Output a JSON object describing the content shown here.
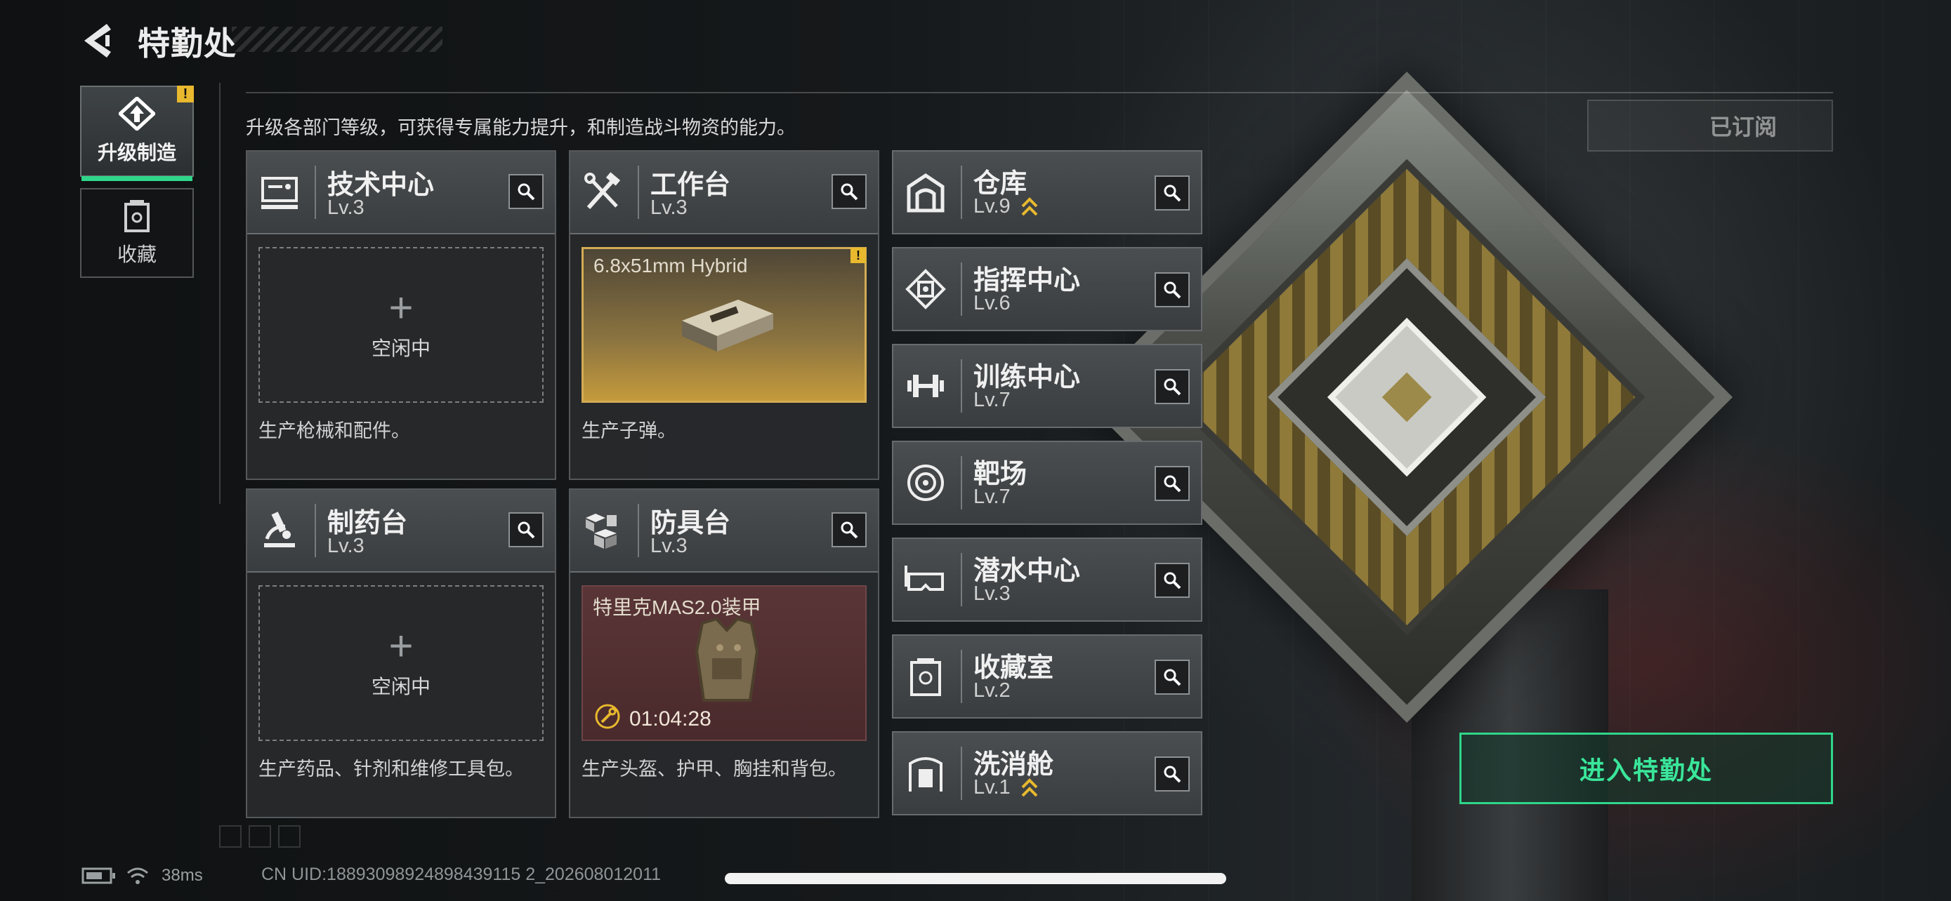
{
  "header": {
    "title": "特勤处",
    "back_icon": "back-arrow-icon"
  },
  "sidebar": {
    "items": [
      {
        "label": "升级制造",
        "icon": "upgrade-craft-icon",
        "active": true,
        "badge": "!"
      },
      {
        "label": "收藏",
        "icon": "collection-icon",
        "active": false
      }
    ]
  },
  "subtitle": "升级各部门等级，可获得专属能力提升，和制造战斗物资的能力。",
  "facilities": {
    "tech_center": {
      "name": "技术中心",
      "level": "Lv.3",
      "icon": "tech-center-icon",
      "slot_status": "空闲中",
      "description": "生产枪械和配件。"
    },
    "workbench": {
      "name": "工作台",
      "level": "Lv.3",
      "icon": "workbench-tools-icon",
      "product": "6.8x51mm Hybrid",
      "product_badge": "!",
      "description": "生产子弹。"
    },
    "pharmacy": {
      "name": "制药台",
      "level": "Lv.3",
      "icon": "microscope-icon",
      "slot_status": "空闲中",
      "description": "生产药品、针剂和维修工具包。"
    },
    "armor_bench": {
      "name": "防具台",
      "level": "Lv.3",
      "icon": "armor-blocks-icon",
      "product": "特里克MAS2.0装甲",
      "timer": "01:04:28",
      "description": "生产头盔、护甲、胸挂和背包。"
    }
  },
  "side_facilities": [
    {
      "name": "仓库",
      "level": "Lv.9",
      "icon": "warehouse-icon",
      "upgradable": true
    },
    {
      "name": "指挥中心",
      "level": "Lv.6",
      "icon": "command-chip-icon",
      "upgradable": false
    },
    {
      "name": "训练中心",
      "level": "Lv.7",
      "icon": "dumbbell-icon",
      "upgradable": false
    },
    {
      "name": "靶场",
      "level": "Lv.7",
      "icon": "target-icon",
      "upgradable": false
    },
    {
      "name": "潜水中心",
      "level": "Lv.3",
      "icon": "diving-mask-icon",
      "upgradable": false
    },
    {
      "name": "收藏室",
      "level": "Lv.2",
      "icon": "collection-room-icon",
      "upgradable": false
    },
    {
      "name": "洗消舱",
      "level": "Lv.1",
      "icon": "decon-pod-icon",
      "upgradable": true
    }
  ],
  "subscribed_label": "已订阅",
  "enter_button": "进入特勤处",
  "status": {
    "ping": "38ms",
    "uid": "CN UID:18893098924898439115 2_202608012011"
  },
  "colors": {
    "accent_green": "#2fd68a",
    "warning_yellow": "#e8b92e",
    "ammo_gold": "#c49a3c"
  }
}
